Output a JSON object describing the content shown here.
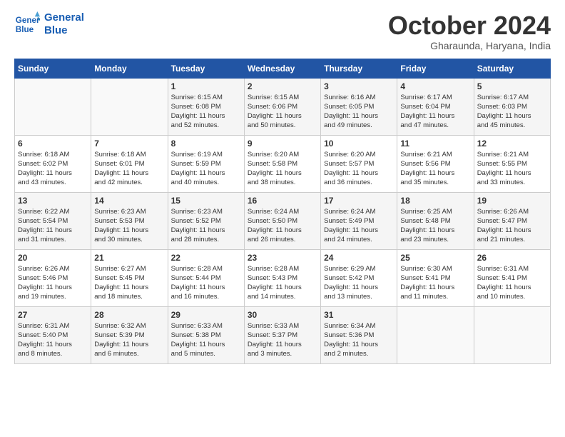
{
  "logo": {
    "line1": "General",
    "line2": "Blue"
  },
  "title": "October 2024",
  "subtitle": "Gharaunda, Haryana, India",
  "header_days": [
    "Sunday",
    "Monday",
    "Tuesday",
    "Wednesday",
    "Thursday",
    "Friday",
    "Saturday"
  ],
  "weeks": [
    [
      {
        "day": "",
        "info": ""
      },
      {
        "day": "",
        "info": ""
      },
      {
        "day": "1",
        "info": "Sunrise: 6:15 AM\nSunset: 6:08 PM\nDaylight: 11 hours\nand 52 minutes."
      },
      {
        "day": "2",
        "info": "Sunrise: 6:15 AM\nSunset: 6:06 PM\nDaylight: 11 hours\nand 50 minutes."
      },
      {
        "day": "3",
        "info": "Sunrise: 6:16 AM\nSunset: 6:05 PM\nDaylight: 11 hours\nand 49 minutes."
      },
      {
        "day": "4",
        "info": "Sunrise: 6:17 AM\nSunset: 6:04 PM\nDaylight: 11 hours\nand 47 minutes."
      },
      {
        "day": "5",
        "info": "Sunrise: 6:17 AM\nSunset: 6:03 PM\nDaylight: 11 hours\nand 45 minutes."
      }
    ],
    [
      {
        "day": "6",
        "info": "Sunrise: 6:18 AM\nSunset: 6:02 PM\nDaylight: 11 hours\nand 43 minutes."
      },
      {
        "day": "7",
        "info": "Sunrise: 6:18 AM\nSunset: 6:01 PM\nDaylight: 11 hours\nand 42 minutes."
      },
      {
        "day": "8",
        "info": "Sunrise: 6:19 AM\nSunset: 5:59 PM\nDaylight: 11 hours\nand 40 minutes."
      },
      {
        "day": "9",
        "info": "Sunrise: 6:20 AM\nSunset: 5:58 PM\nDaylight: 11 hours\nand 38 minutes."
      },
      {
        "day": "10",
        "info": "Sunrise: 6:20 AM\nSunset: 5:57 PM\nDaylight: 11 hours\nand 36 minutes."
      },
      {
        "day": "11",
        "info": "Sunrise: 6:21 AM\nSunset: 5:56 PM\nDaylight: 11 hours\nand 35 minutes."
      },
      {
        "day": "12",
        "info": "Sunrise: 6:21 AM\nSunset: 5:55 PM\nDaylight: 11 hours\nand 33 minutes."
      }
    ],
    [
      {
        "day": "13",
        "info": "Sunrise: 6:22 AM\nSunset: 5:54 PM\nDaylight: 11 hours\nand 31 minutes."
      },
      {
        "day": "14",
        "info": "Sunrise: 6:23 AM\nSunset: 5:53 PM\nDaylight: 11 hours\nand 30 minutes."
      },
      {
        "day": "15",
        "info": "Sunrise: 6:23 AM\nSunset: 5:52 PM\nDaylight: 11 hours\nand 28 minutes."
      },
      {
        "day": "16",
        "info": "Sunrise: 6:24 AM\nSunset: 5:50 PM\nDaylight: 11 hours\nand 26 minutes."
      },
      {
        "day": "17",
        "info": "Sunrise: 6:24 AM\nSunset: 5:49 PM\nDaylight: 11 hours\nand 24 minutes."
      },
      {
        "day": "18",
        "info": "Sunrise: 6:25 AM\nSunset: 5:48 PM\nDaylight: 11 hours\nand 23 minutes."
      },
      {
        "day": "19",
        "info": "Sunrise: 6:26 AM\nSunset: 5:47 PM\nDaylight: 11 hours\nand 21 minutes."
      }
    ],
    [
      {
        "day": "20",
        "info": "Sunrise: 6:26 AM\nSunset: 5:46 PM\nDaylight: 11 hours\nand 19 minutes."
      },
      {
        "day": "21",
        "info": "Sunrise: 6:27 AM\nSunset: 5:45 PM\nDaylight: 11 hours\nand 18 minutes."
      },
      {
        "day": "22",
        "info": "Sunrise: 6:28 AM\nSunset: 5:44 PM\nDaylight: 11 hours\nand 16 minutes."
      },
      {
        "day": "23",
        "info": "Sunrise: 6:28 AM\nSunset: 5:43 PM\nDaylight: 11 hours\nand 14 minutes."
      },
      {
        "day": "24",
        "info": "Sunrise: 6:29 AM\nSunset: 5:42 PM\nDaylight: 11 hours\nand 13 minutes."
      },
      {
        "day": "25",
        "info": "Sunrise: 6:30 AM\nSunset: 5:41 PM\nDaylight: 11 hours\nand 11 minutes."
      },
      {
        "day": "26",
        "info": "Sunrise: 6:31 AM\nSunset: 5:41 PM\nDaylight: 11 hours\nand 10 minutes."
      }
    ],
    [
      {
        "day": "27",
        "info": "Sunrise: 6:31 AM\nSunset: 5:40 PM\nDaylight: 11 hours\nand 8 minutes."
      },
      {
        "day": "28",
        "info": "Sunrise: 6:32 AM\nSunset: 5:39 PM\nDaylight: 11 hours\nand 6 minutes."
      },
      {
        "day": "29",
        "info": "Sunrise: 6:33 AM\nSunset: 5:38 PM\nDaylight: 11 hours\nand 5 minutes."
      },
      {
        "day": "30",
        "info": "Sunrise: 6:33 AM\nSunset: 5:37 PM\nDaylight: 11 hours\nand 3 minutes."
      },
      {
        "day": "31",
        "info": "Sunrise: 6:34 AM\nSunset: 5:36 PM\nDaylight: 11 hours\nand 2 minutes."
      },
      {
        "day": "",
        "info": ""
      },
      {
        "day": "",
        "info": ""
      }
    ]
  ]
}
